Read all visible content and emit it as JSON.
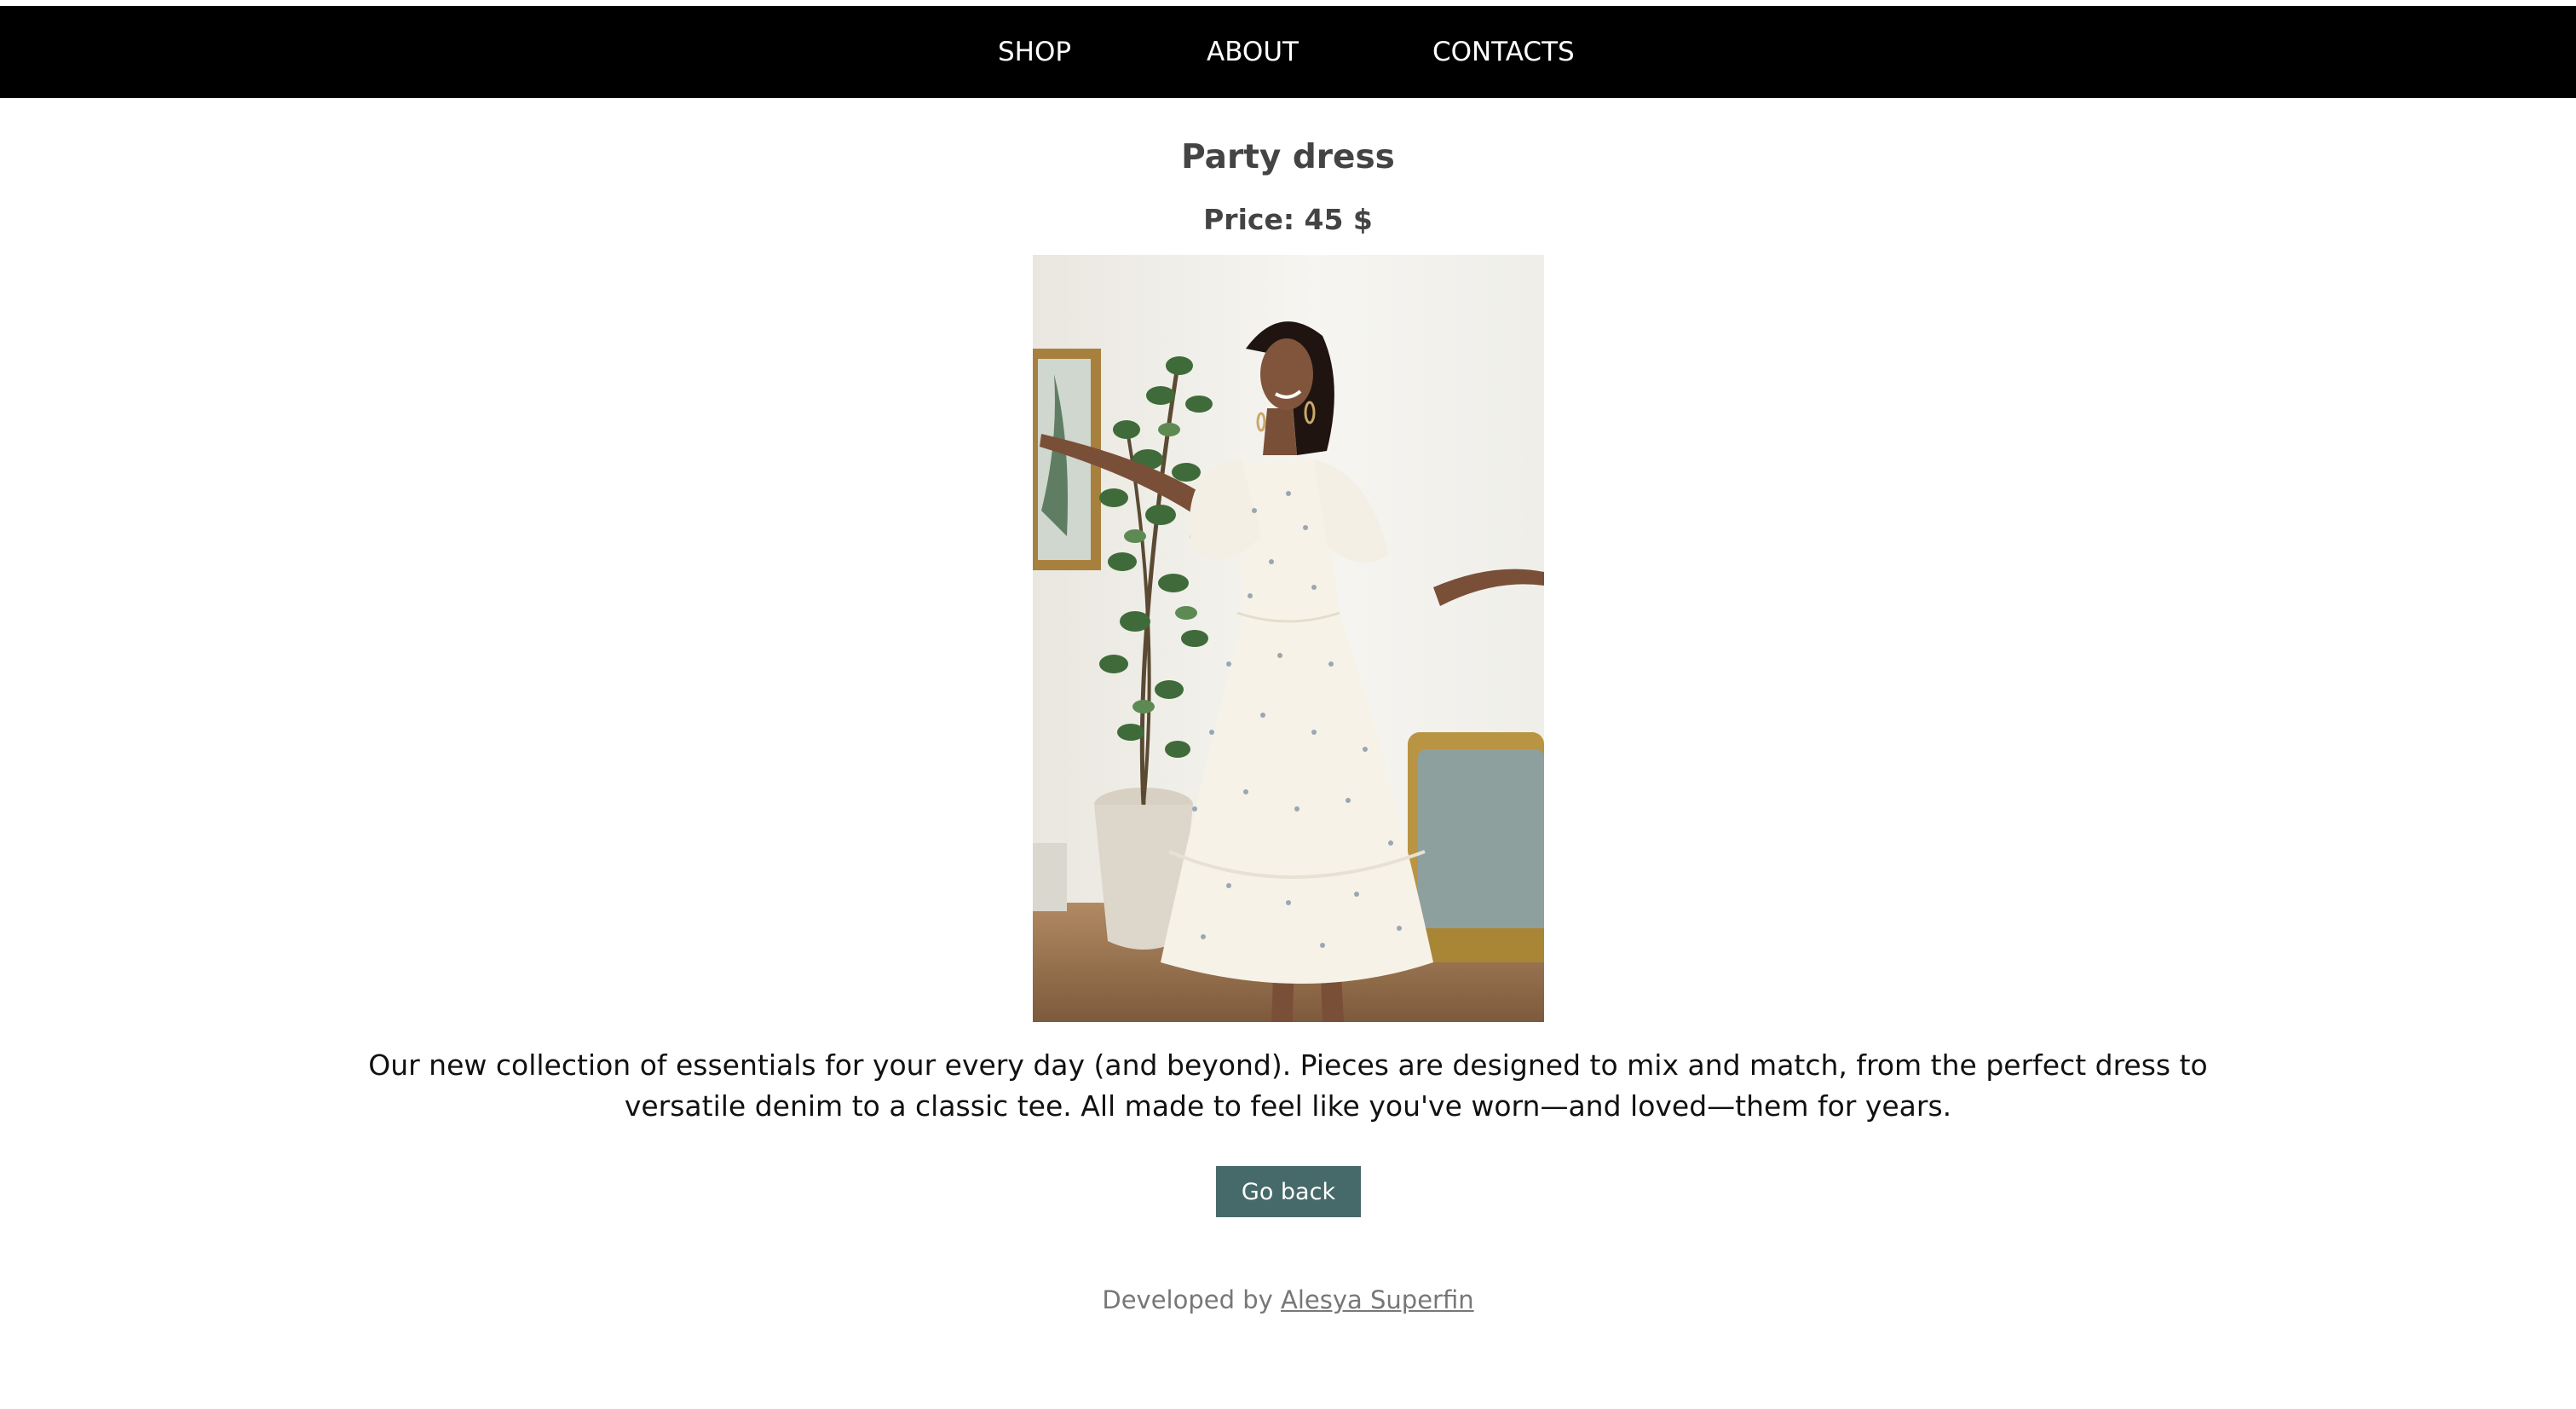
{
  "nav": {
    "items": [
      {
        "label": "SHOP"
      },
      {
        "label": "ABOUT"
      },
      {
        "label": "CONTACTS"
      }
    ]
  },
  "product": {
    "title": "Party dress",
    "price": "Price: 45 $",
    "image_alt": "Party dress",
    "description": "Our new collection of essentials for your every day (and beyond). Pieces are designed to mix and match, from the perfect dress to versatile denim to a classic tee. All made to feel like you've worn—and loved—them for years."
  },
  "actions": {
    "go_back_label": "Go back"
  },
  "footer": {
    "prefix": "Developed by",
    "author_link": "Alesya Superfin"
  },
  "colors": {
    "nav_background": "#000000",
    "button_background": "#466a69",
    "heading_text": "#444444",
    "footer_text": "#777777"
  }
}
